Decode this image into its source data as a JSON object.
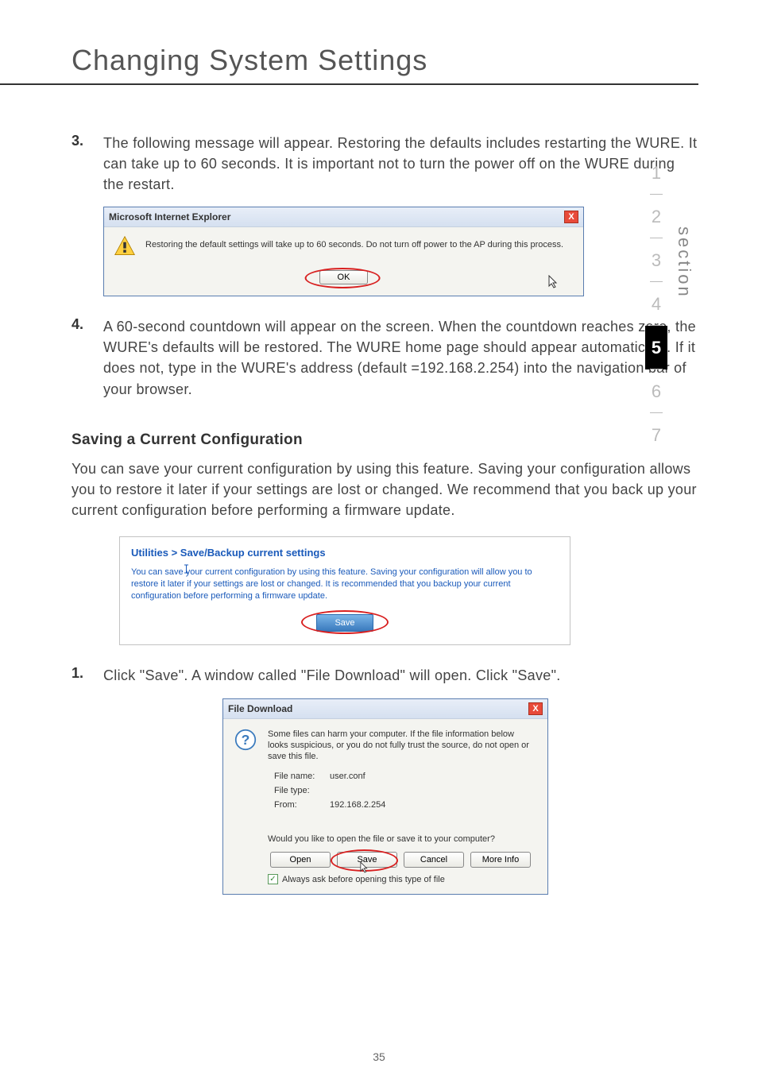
{
  "page_title": "Changing System Settings",
  "steps": {
    "s3": {
      "num": "3.",
      "text": "The  following message will appear. Restoring the defaults includes restarting the WURE. It can take up to 60 seconds. It is important not to turn the power off on the WURE during the restart."
    },
    "s4": {
      "num": "4.",
      "text": "A 60-second countdown will appear on the screen. When the countdown reaches zero, the WURE's defaults will be restored. The WURE home page should appear automatically. If it does not, type in the WURE's address (default =192.168.2.254) into the navigation bar of your browser."
    },
    "s1": {
      "num": "1.",
      "text": "Click \"Save\". A window called \"File Download\" will open. Click \"Save\"."
    }
  },
  "dialogs": {
    "ie_alert": {
      "title": "Microsoft Internet Explorer",
      "message": "Restoring the default settings will take up to 60 seconds. Do not turn off power to the AP during this process.",
      "ok_label": "OK"
    },
    "web_panel": {
      "title": "Utilities > Save/Backup current settings",
      "text": "You can save your current configuration by using this feature. Saving your configuration will allow you to restore it later if your settings are lost or changed. It is recommended that you backup your current configuration before performing a firmware update.",
      "save_label": "Save"
    },
    "file_download": {
      "title": "File Download",
      "warning": "Some files can harm your computer. If the file information below looks suspicious, or you do not fully trust the source, do not open or save this file.",
      "file_name_label": "File name:",
      "file_name_value": "user.conf",
      "file_type_label": "File type:",
      "file_type_value": "",
      "from_label": "From:",
      "from_value": "192.168.2.254",
      "question": "Would you like to open the file or save it to your computer?",
      "open_label": "Open",
      "save_label": "Save",
      "cancel_label": "Cancel",
      "more_info_label": "More Info",
      "checkbox_label": "Always ask before opening this type of file"
    }
  },
  "section_heading": "Saving a Current Configuration",
  "body_paragraph": "You can save your current configuration by using this feature. Saving your configuration allows you to restore it later if your settings are lost or changed. We recommend that you back up your current configuration before performing a firmware update.",
  "side_nav": {
    "items": [
      "1",
      "2",
      "3",
      "4",
      "5",
      "6",
      "7"
    ],
    "active_index": 4,
    "label": "section"
  },
  "page_number": "35",
  "close_x": "X"
}
